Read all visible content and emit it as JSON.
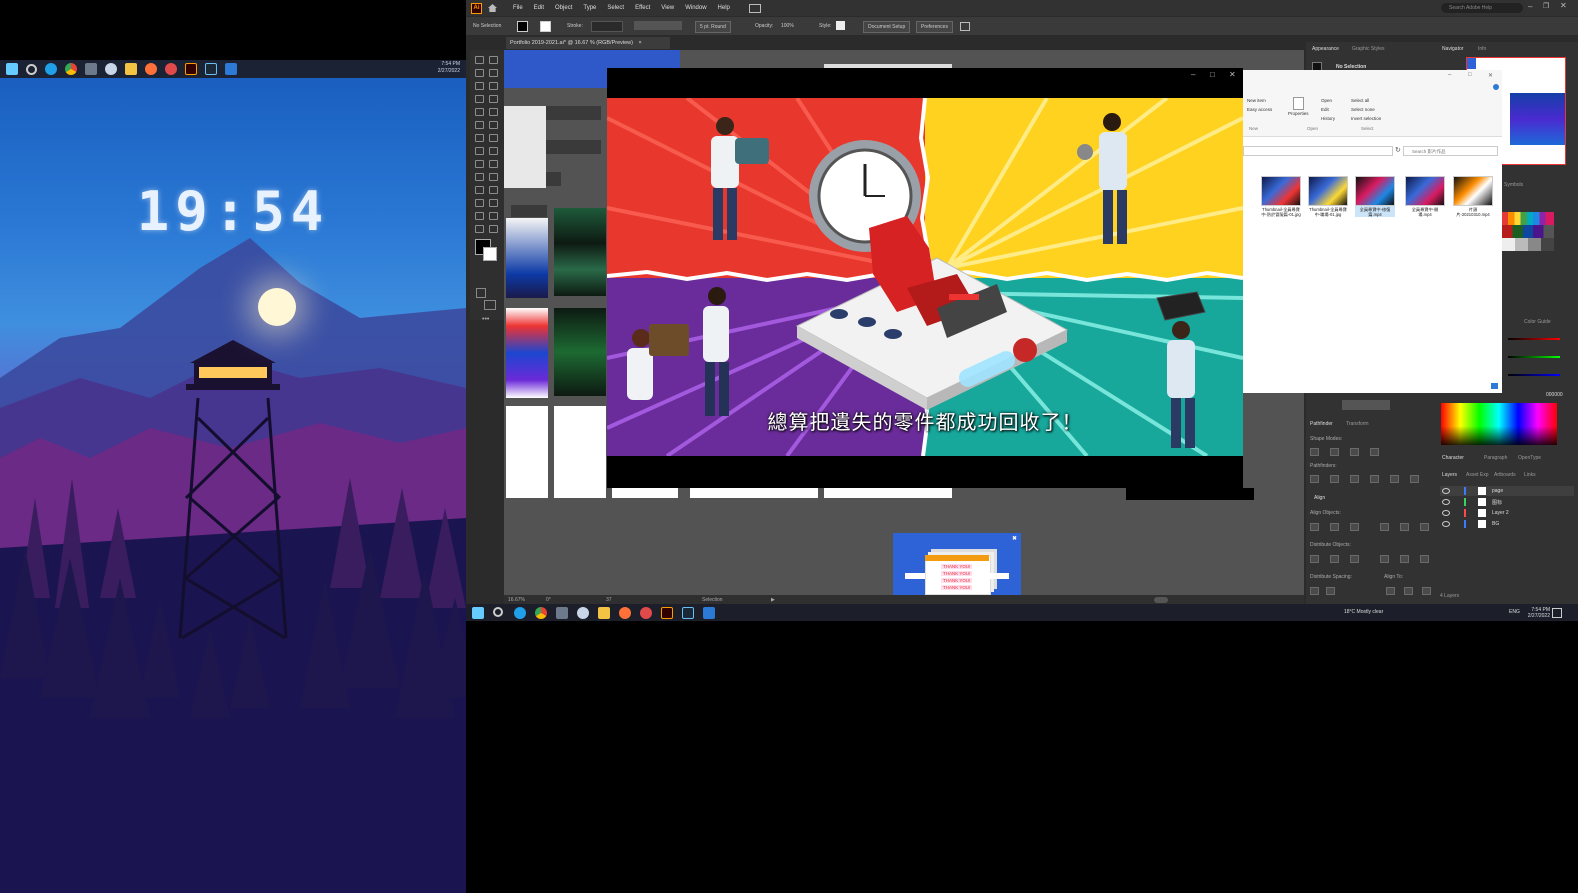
{
  "left_monitor": {
    "taskbar_time": "7:54 PM",
    "taskbar_date": "2/27/2022",
    "wallpaper_clock": "19:54"
  },
  "illustrator": {
    "app_icon": "Ai",
    "menus": [
      "File",
      "Edit",
      "Object",
      "Type",
      "Select",
      "Effect",
      "View",
      "Window",
      "Help"
    ],
    "search_placeholder": "Search Adobe Help",
    "control_bar": {
      "selection": "No Selection",
      "stroke_label": "Stroke:",
      "brush": "5 pt. Round",
      "opacity_label": "Opacity:",
      "opacity_value": "100%",
      "style_label": "Style:",
      "document_setup": "Document Setup",
      "preferences": "Preferences"
    },
    "document_tab": "Portfolio 2019-2021.ai* @ 16.67 % (RGB/Preview)",
    "status": {
      "zoom": "16.67%",
      "rotation": "0°",
      "artboard_number": "37",
      "tool_name": "Selection"
    },
    "panels": {
      "appearance_tab": "Appearance",
      "graphic_styles_tab": "Graphic Styles",
      "appearance_selection": "No Selection",
      "pathfinder_tab": "Pathfinder",
      "transform_tab": "Transform",
      "shape_modes_label": "Shape Modes:",
      "pathfinders_label": "Pathfinders:",
      "align_tab": "Align",
      "align_objects_label": "Align Objects:",
      "distribute_objects_label": "Distribute Objects:",
      "distribute_spacing_label": "Distribute Spacing:",
      "align_to_label": "Align To:",
      "navigator_tab": "Navigator",
      "info_tab": "Info",
      "symbols_tab": "Symbols",
      "color_guide_tab": "Color Guide",
      "character_tab": "Character",
      "paragraph_tab": "Paragraph",
      "opentype_tab": "OpenType",
      "layers_tab": "Layers",
      "asset_export_tab": "Asset Exp",
      "artboards_tab": "Artboards",
      "links_tab": "Links",
      "layers": [
        "page",
        "图标",
        "Layer 2",
        "BG"
      ],
      "layers_count": "4 Layers",
      "color_hex": "000000"
    }
  },
  "video_player": {
    "subtitle": "總算把遺失的零件都成功回收了！"
  },
  "file_explorer": {
    "ribbon": {
      "new_item": "New item",
      "easy_access": "Easy access",
      "new_group": "New",
      "properties": "Properties",
      "open": "Open",
      "edit": "Edit",
      "history": "History",
      "open_group": "Open",
      "select_all": "Select all",
      "select_none": "Select none",
      "invert_selection": "Invert selection",
      "select_group": "Select"
    },
    "search_placeholder": "Search 影片作品",
    "files": [
      {
        "name": "Thumbnail-全員尋寶中-防於冒險篇-01.jpg"
      },
      {
        "name": "Thumbnail-全員尋寶中-職場-01.jpg"
      },
      {
        "name": "全員尋寶中-修復篇.mp4"
      },
      {
        "name": "全員尋寶中-開場.mp4"
      },
      {
        "name": "片頭片-20210310.mp4"
      }
    ]
  },
  "right_taskbar": {
    "weather": "18°C  Mostly clear",
    "language": "ENG",
    "time": "7:54 PM",
    "date": "2/27/2022"
  },
  "popup_buttons": [
    "THANK YOU!",
    "THANK YOU!",
    "THANK YOU!",
    "THANK YOU!"
  ]
}
